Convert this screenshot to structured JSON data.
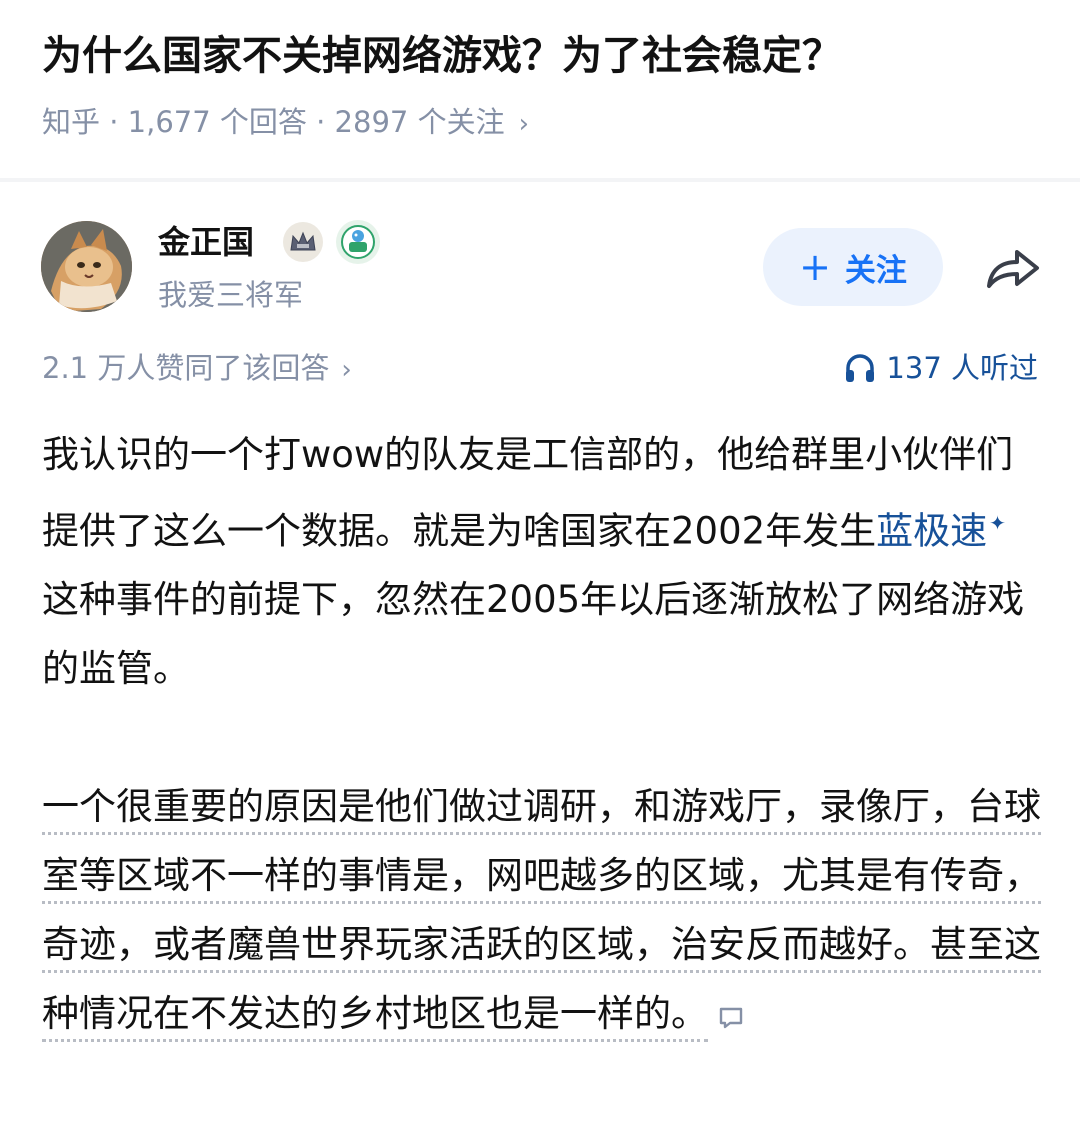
{
  "question": {
    "title": "为什么国家不关掉网络游戏？为了社会稳定？",
    "meta": "知乎 · 1,677 个回答 · 2897 个关注",
    "chevron": "›"
  },
  "author": {
    "name": "金正国",
    "bio": "我爱三将军"
  },
  "follow_button": {
    "plus": "+",
    "label": "关注"
  },
  "stats": {
    "upvotes": "2.1 万人赞同了该回答",
    "chevron": "›",
    "listens": "137 人听过"
  },
  "answer": {
    "para1_before": "我认识的一个打wow的队友是工信部的，他给群里小伙伴们提供了这么一个数据。就是为啥国家在2002年发生",
    "para1_link": "蓝极速",
    "para1_after": "这种事件的前提下，忽然在2005年以后逐渐放松了网络游戏的监管。",
    "para2": "一个很重要的原因是他们做过调研，和游戏厅，录像厅，台球室等区域不一样的事情是，网吧越多的区域，尤其是有传奇，奇迹，或者魔兽世界玩家活跃的区域，治安反而越好。甚至这种情况在不发达的乡村地区也是一样的。"
  },
  "colors": {
    "accent": "#1772f6",
    "link": "#175199",
    "muted": "#8590a6",
    "follow_bg": "#ebf2fd"
  },
  "icons": [
    "avatar-cat",
    "crown-badge-icon",
    "bubble-badge-icon",
    "share-icon",
    "headphones-icon",
    "comment-icon"
  ]
}
